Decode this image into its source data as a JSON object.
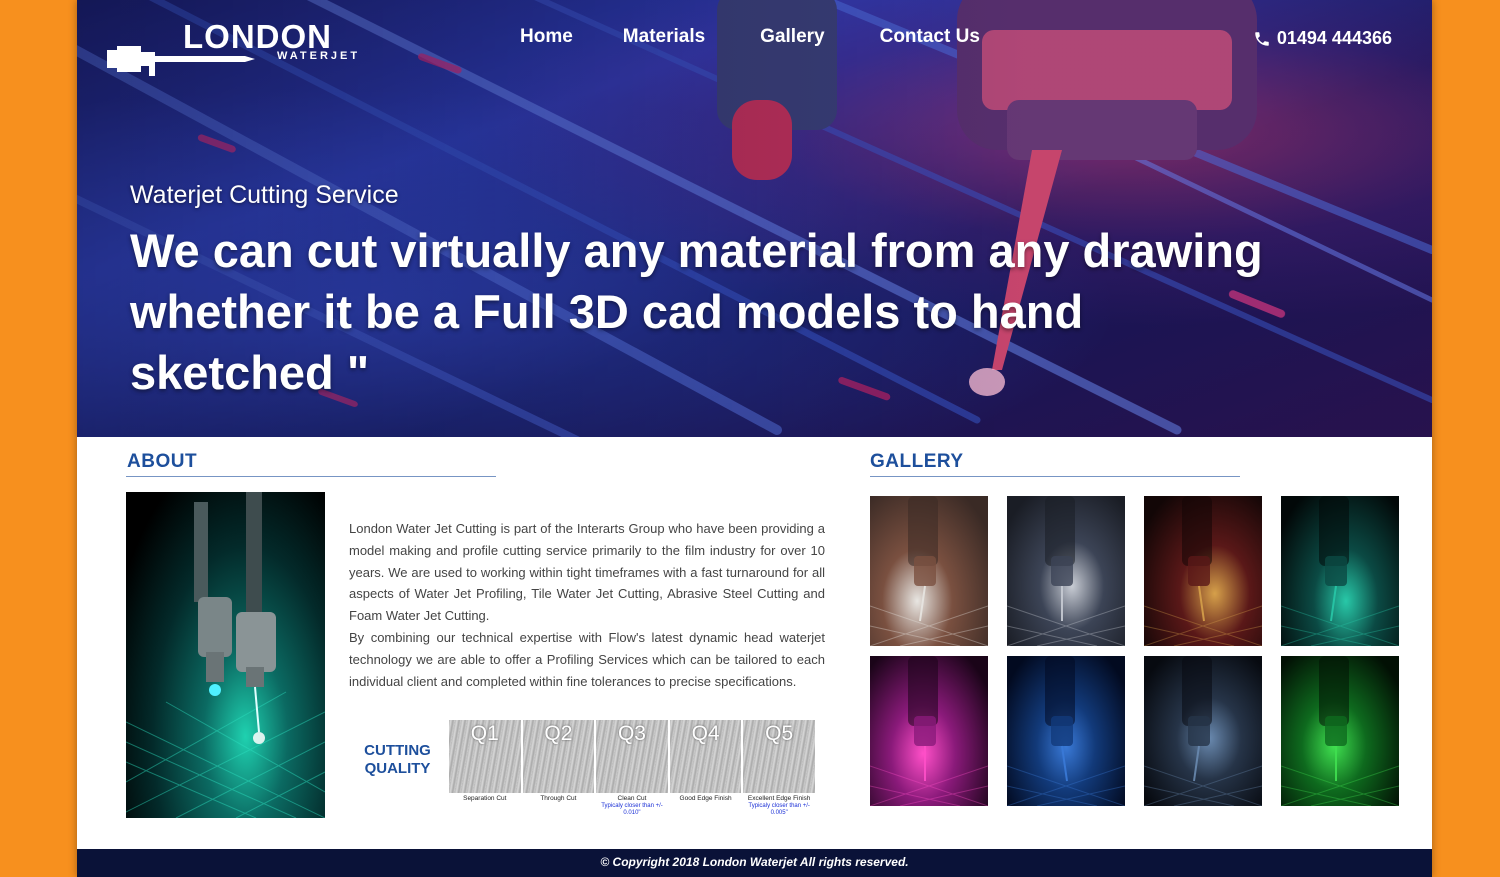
{
  "brand": {
    "name": "LONDON",
    "sub": "WATERJET"
  },
  "nav": {
    "items": [
      "Home",
      "Materials",
      "Gallery",
      "Contact Us"
    ]
  },
  "contact": {
    "phone": "01494 444366",
    "icon": "phone-icon"
  },
  "hero": {
    "subtitle": "Waterjet Cutting Service",
    "headline": "We can cut virtually any material from any drawing whether it be a Full 3D cad models to hand sketched \""
  },
  "about": {
    "title": "ABOUT",
    "paragraphs": [
      "London Water Jet Cutting is part of the Interarts Group who have been providing a model making and profile cutting service primarily to the film industry for over 10 years. We are used to working within tight timeframes with a fast turnaround for all aspects of Water Jet Profiling, Tile Water Jet Cutting, Abrasive Steel Cutting and Foam Water Jet Cutting.",
      "By combining our technical expertise with Flow's latest dynamic head waterjet technology we are able to offer a Profiling Services which can be tailored to each individual client and completed within fine tolerances to precise specifications."
    ]
  },
  "cutting_quality": {
    "label_line1": "CUTTING",
    "label_line2": "QUALITY",
    "levels": [
      {
        "code": "Q1",
        "caption": "Separation Cut",
        "note": ""
      },
      {
        "code": "Q2",
        "caption": "Through Cut",
        "note": ""
      },
      {
        "code": "Q3",
        "caption": "Clean Cut",
        "note": "Typicaly closer than +/- 0.010\""
      },
      {
        "code": "Q4",
        "caption": "Good Edge Finish",
        "note": ""
      },
      {
        "code": "Q5",
        "caption": "Excellent Edge Finish",
        "note": "Typicaly closer than +/- 0.005\""
      }
    ]
  },
  "gallery": {
    "title": "GALLERY",
    "items": [
      {
        "name": "gallery-image-1",
        "colors": [
          "#e8e6e2",
          "#7a5040",
          "#3a2a25"
        ]
      },
      {
        "name": "gallery-image-2",
        "colors": [
          "#c8ccd4",
          "#3c4456",
          "#1a1d25"
        ]
      },
      {
        "name": "gallery-image-3",
        "colors": [
          "#d6a04a",
          "#5a1818",
          "#120606"
        ]
      },
      {
        "name": "gallery-image-4",
        "colors": [
          "#28c8a8",
          "#0b4a44",
          "#020808"
        ]
      },
      {
        "name": "gallery-image-5",
        "colors": [
          "#ff4fc8",
          "#8a1a7a",
          "#1a0418"
        ]
      },
      {
        "name": "gallery-image-6",
        "colors": [
          "#3a7ad8",
          "#123a7a",
          "#020a20"
        ]
      },
      {
        "name": "gallery-image-7",
        "colors": [
          "#6a8ab0",
          "#263448",
          "#070a10"
        ]
      },
      {
        "name": "gallery-image-8",
        "colors": [
          "#40e050",
          "#0e6a1e",
          "#021004"
        ]
      }
    ]
  },
  "footer": {
    "copyright": "© Copyright  2018  London Waterjet  All rights reserved."
  },
  "colors": {
    "page_bg": "#f7901e",
    "accent": "#1d4f9c",
    "footer_bg": "#0a1238",
    "note_blue": "#1a2fd6"
  }
}
